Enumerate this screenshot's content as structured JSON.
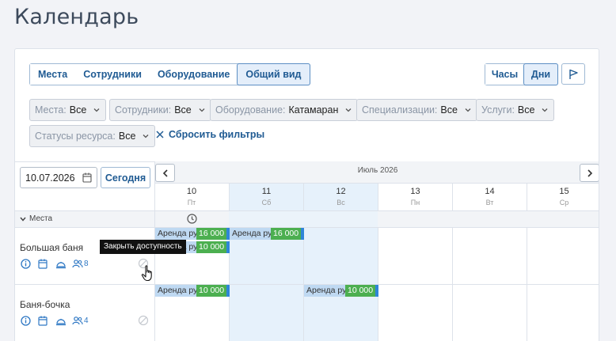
{
  "page": {
    "title": "Календарь"
  },
  "view_tabs": [
    "Места",
    "Сотрудники",
    "Оборудование",
    "Общий вид"
  ],
  "view_tabs_active": "Общий вид",
  "scale_tabs": [
    "Часы",
    "Дни"
  ],
  "scale_tabs_active": "Дни",
  "filters": [
    {
      "label": "Места:",
      "value": "Все"
    },
    {
      "label": "Сотрудники:",
      "value": "Все"
    },
    {
      "label": "Оборудование:",
      "value": "Катамаран"
    },
    {
      "label": "Специализации:",
      "value": "Все"
    },
    {
      "label": "Услуги:",
      "value": "Все"
    },
    {
      "label": "Статусы ресурса:",
      "value": "Все"
    }
  ],
  "reset_filters_label": "Сбросить фильтры",
  "date_value": "10.07.2026",
  "today_label": "Сегодня",
  "month_label": "Июль 2026",
  "days": [
    {
      "num": "10",
      "name": "Пт",
      "highlight": false
    },
    {
      "num": "11",
      "name": "Сб",
      "highlight": true
    },
    {
      "num": "12",
      "name": "Вс",
      "highlight": true
    },
    {
      "num": "13",
      "name": "Пн",
      "highlight": false
    },
    {
      "num": "14",
      "name": "Вт",
      "highlight": false
    },
    {
      "num": "15",
      "name": "Ср",
      "highlight": false
    }
  ],
  "group_label": "Места",
  "resources": [
    {
      "name": "Большая баня",
      "capacity": "8",
      "bookings": [
        {
          "day": 0,
          "lane": 0,
          "name": "Аренда ру",
          "price": "16 000"
        },
        {
          "day": 1,
          "lane": 0,
          "name": "Аренда ру",
          "price": "16 000"
        },
        {
          "day": 0,
          "lane": 1,
          "name": "Аренда ру",
          "price": "10 000"
        }
      ]
    },
    {
      "name": "Баня-бочка",
      "capacity": "4",
      "bookings": [
        {
          "day": 0,
          "lane": 0,
          "name": "Аренда ру",
          "price": "10 000"
        },
        {
          "day": 2,
          "lane": 0,
          "name": "Аренда ру",
          "price": "10 000"
        }
      ]
    }
  ],
  "tooltip": "Закрыть доступность",
  "colors": {
    "accent": "#205b93",
    "highlight_col": "#e6f1fb",
    "booking_bg": "#bfd9f2",
    "price_bg": "#4caf50",
    "booking_end": "#2f85d8"
  }
}
